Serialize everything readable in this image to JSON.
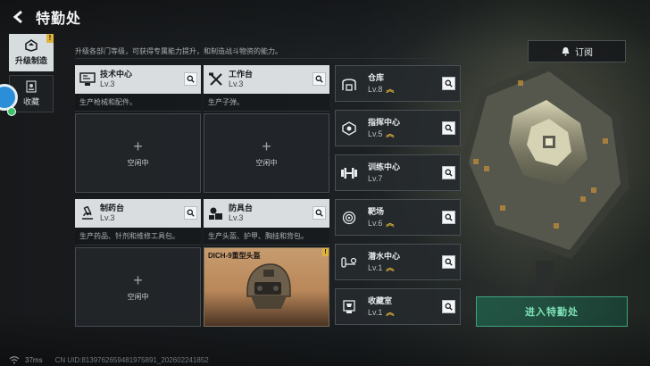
{
  "header": {
    "title": "特勤处"
  },
  "tabs": [
    {
      "label": "升级制造",
      "active": true,
      "has_badge": true,
      "badge": "!"
    },
    {
      "label": "收藏",
      "active": false
    }
  ],
  "description": "升级各部门等级，可获得专属能力提升，和制造战斗物资的能力。",
  "subscribe": {
    "label": "订阅"
  },
  "workshops": [
    {
      "name": "技术中心",
      "level": "Lv.3",
      "desc": "生产枪械和配件。",
      "slot": {
        "plus": "+",
        "status": "空闲中"
      }
    },
    {
      "name": "工作台",
      "level": "Lv.3",
      "desc": "生产子弹。",
      "slot": {
        "plus": "+",
        "status": "空闲中"
      }
    },
    {
      "name": "制药台",
      "level": "Lv.3",
      "desc": "生产药品、针剂和维修工具包。",
      "slot": {
        "plus": "+",
        "status": "空闲中"
      }
    },
    {
      "name": "防具台",
      "level": "Lv.3",
      "desc": "生产头盔、护甲、胸挂和背包。",
      "item": {
        "name": "DICH-9重型头盔",
        "badge": "!"
      }
    }
  ],
  "facilities": [
    {
      "name": "仓库",
      "level": "Lv.8",
      "upgradable": true,
      "icon": "warehouse-icon"
    },
    {
      "name": "指挥中心",
      "level": "Lv.5",
      "upgradable": true,
      "icon": "command-icon"
    },
    {
      "name": "训练中心",
      "level": "Lv.7",
      "upgradable": false,
      "icon": "dumbbell-icon"
    },
    {
      "name": "靶场",
      "level": "Lv.6",
      "upgradable": true,
      "icon": "target-icon"
    },
    {
      "name": "潜水中心",
      "level": "Lv.1",
      "upgradable": true,
      "icon": "diving-icon"
    },
    {
      "name": "收藏室",
      "level": "Lv.1",
      "upgradable": true,
      "icon": "trophy-icon"
    }
  ],
  "up_glyph": "︽",
  "enter_button": {
    "label": "进入特勤处"
  },
  "footer": {
    "ping": "37ms",
    "uid": "CN UID:8139762659481975891_202602241852"
  },
  "colors": {
    "accent_green": "#3fa37b",
    "badge_yellow": "#e0b43a",
    "card_header": "#d9dde0"
  }
}
